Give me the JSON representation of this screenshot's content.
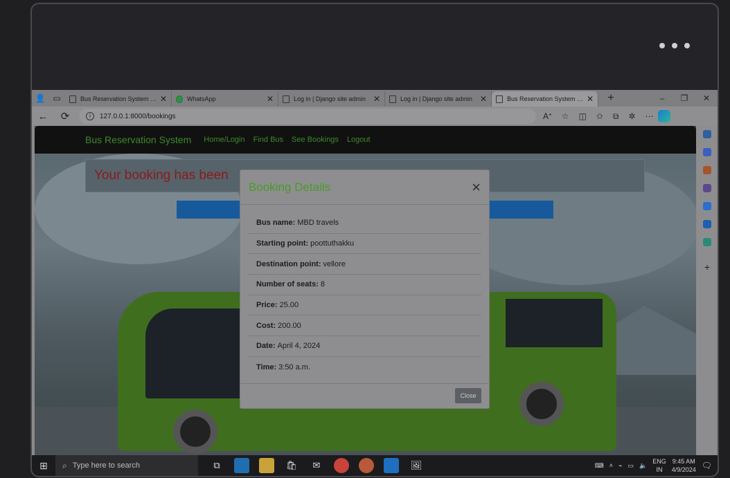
{
  "browser": {
    "tabs": [
      {
        "label": "Bus Reservation System in Dj",
        "active": false,
        "icon": "page-icon"
      },
      {
        "label": "WhatsApp",
        "active": false,
        "icon": "whatsapp-icon"
      },
      {
        "label": "Log in | Django site admin",
        "active": false,
        "icon": "page-icon"
      },
      {
        "label": "Log in | Django site admin",
        "active": false,
        "icon": "page-icon"
      },
      {
        "label": "Bus Reservation System in Dj",
        "active": true,
        "icon": "page-icon"
      }
    ],
    "new_tab": "+",
    "window_controls": {
      "minimize": "–",
      "restore": "❐",
      "close": "✕"
    },
    "url": "127.0.0.1:8000/bookings",
    "nav": {
      "back": "←",
      "reload": "⟳",
      "info": "i"
    }
  },
  "navbar": {
    "brand": "Bus Reservation System",
    "links": [
      "Home/Login",
      "Find Bus",
      "See Bookings",
      "Logout"
    ]
  },
  "alert": {
    "text": "Your booking has been"
  },
  "modal": {
    "title": "Booking Details",
    "close_icon": "×",
    "rows": [
      {
        "label": "Bus name:",
        "value": "MBD travels"
      },
      {
        "label": "Starting point:",
        "value": "poottuthakku"
      },
      {
        "label": "Destination point:",
        "value": "vellore"
      },
      {
        "label": "Number of seats:",
        "value": "8"
      },
      {
        "label": "Price:",
        "value": "25.00"
      },
      {
        "label": "Cost:",
        "value": "200.00"
      },
      {
        "label": "Date:",
        "value": "April 4, 2024"
      },
      {
        "label": "Time:",
        "value": "3:50 a.m."
      }
    ],
    "close_button": "Close"
  },
  "taskbar": {
    "search_placeholder": "Type here to search",
    "language": {
      "line1": "ENG",
      "line2": "IN"
    },
    "clock": {
      "time": "9:45 AM",
      "date": "4/9/2024"
    }
  },
  "colors": {
    "brand_green": "#4a9a28",
    "alert_red": "#8a1b1b",
    "accent_blue": "#165a9c"
  }
}
